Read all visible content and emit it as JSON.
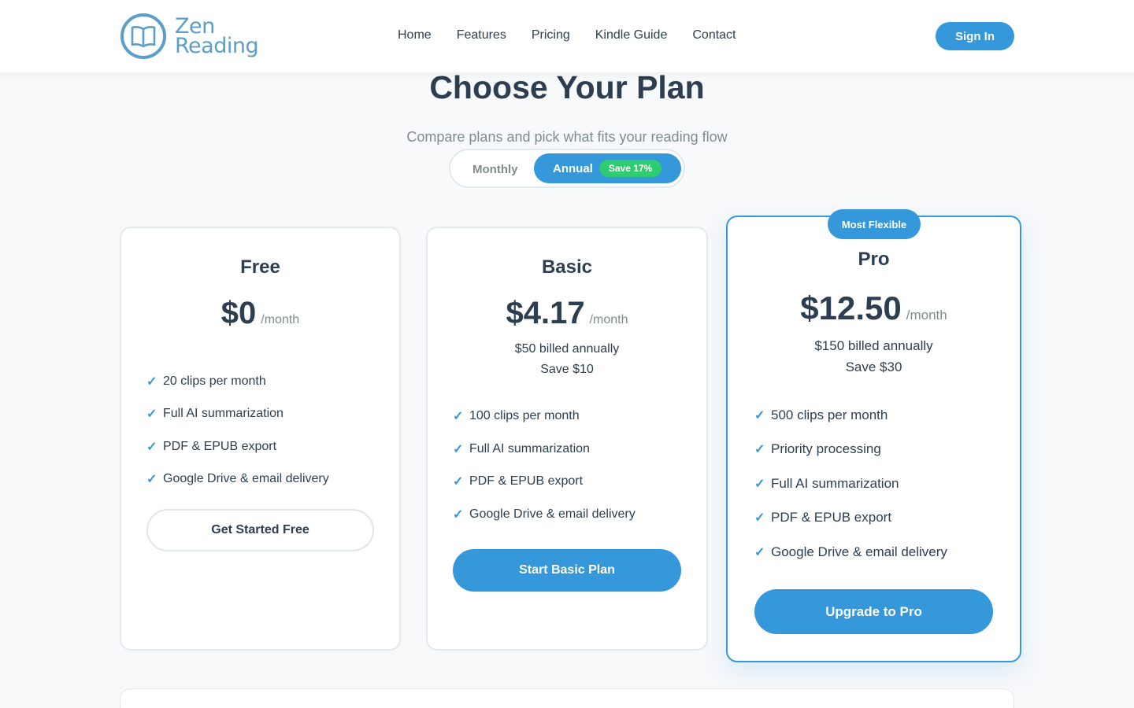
{
  "brand": {
    "line1": "Zen",
    "line2": "Reading",
    "logo_icon": "open-book-icon",
    "accent": "#3498db",
    "logo_color": "#5b9ec9"
  },
  "nav": {
    "items": [
      "Home",
      "Features",
      "Pricing",
      "Kindle Guide",
      "Contact"
    ],
    "sign_in": "Sign In"
  },
  "hero": {
    "title": "Choose Your Plan",
    "subtitle": "Compare plans and pick what fits your reading flow"
  },
  "billing_toggle": {
    "monthly": "Monthly",
    "annual": "Annual",
    "selected": "Annual",
    "save_badge": "Save 17%",
    "save_badge_color": "#2ecc71"
  },
  "plans": [
    {
      "name": "Free",
      "price": "$0",
      "period": "/month",
      "billing": "",
      "savings": "",
      "features": [
        "20 clips per month",
        "Full AI summarization",
        "PDF & EPUB export",
        "Google Drive & email delivery"
      ],
      "cta": "Get Started Free"
    },
    {
      "name": "Basic",
      "price": "$4.17",
      "period": "/month",
      "billing": "$50 billed annually",
      "savings": "Save $10",
      "features": [
        "100 clips per month",
        "Full AI summarization",
        "PDF & EPUB export",
        "Google Drive & email delivery"
      ],
      "cta": "Start Basic Plan"
    },
    {
      "name": "Pro",
      "badge": "Most Flexible",
      "price": "$12.50",
      "period": "/month",
      "billing": "$150 billed annually",
      "savings": "Save $30",
      "features": [
        "500 clips per month",
        "Priority processing",
        "Full AI summarization",
        "PDF & EPUB export",
        "Google Drive & email delivery"
      ],
      "cta": "Upgrade to Pro"
    }
  ]
}
